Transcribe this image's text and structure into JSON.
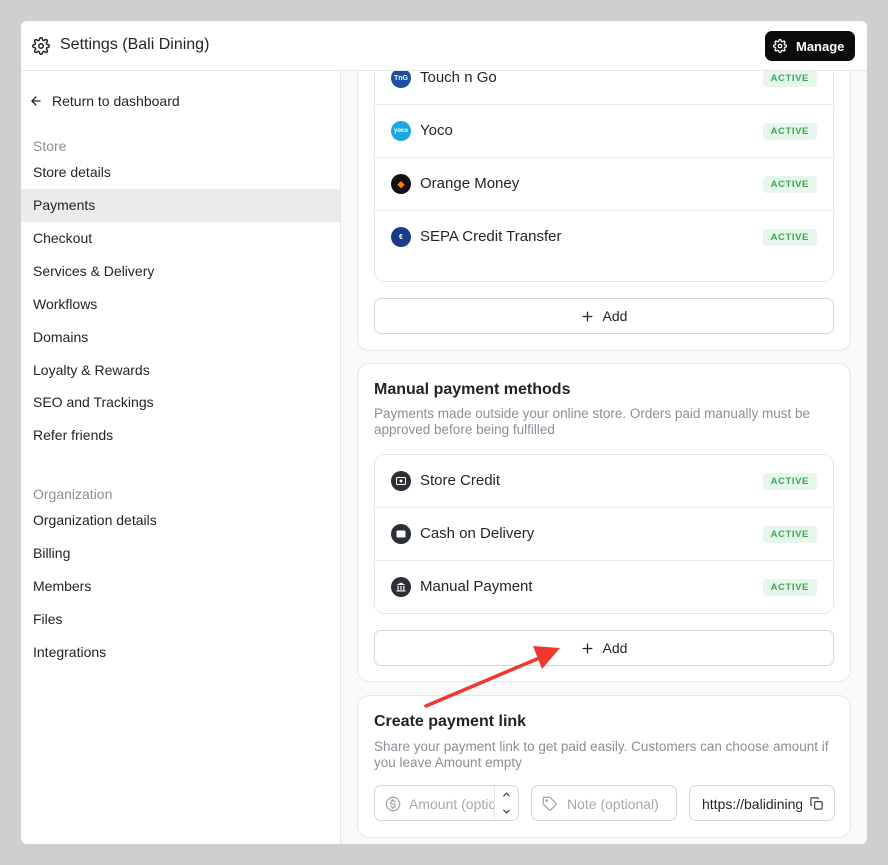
{
  "header": {
    "title": "Settings (Bali Dining)",
    "manage_label": "Manage"
  },
  "sidebar": {
    "back_label": "Return to dashboard",
    "store_label": "Store",
    "store_items": [
      "Store details",
      "Payments",
      "Checkout",
      "Services & Delivery",
      "Workflows",
      "Domains",
      "Loyalty & Rewards",
      "SEO and Trackings",
      "Refer friends"
    ],
    "org_label": "Organization",
    "org_items": [
      "Organization details",
      "Billing",
      "Members",
      "Files",
      "Integrations"
    ],
    "active_item": "Payments"
  },
  "online_methods": {
    "items": [
      {
        "name": "Touch n Go",
        "status": "ACTIVE",
        "icon": "touch-n-go-icon",
        "color": "#1a4fa3"
      },
      {
        "name": "Yoco",
        "status": "ACTIVE",
        "icon": "yoco-icon",
        "color": "#19a8e0"
      },
      {
        "name": "Orange Money",
        "status": "ACTIVE",
        "icon": "orange-money-icon",
        "color": "#111111"
      },
      {
        "name": "SEPA Credit Transfer",
        "status": "ACTIVE",
        "icon": "sepa-icon",
        "color": "#1c3a8a"
      }
    ],
    "add_label": "Add"
  },
  "manual_methods": {
    "title": "Manual payment methods",
    "description": "Payments made outside your online store. Orders paid manually must be approved before being fulfilled",
    "items": [
      {
        "name": "Store Credit",
        "status": "ACTIVE",
        "icon": "store-credit-icon"
      },
      {
        "name": "Cash on Delivery",
        "status": "ACTIVE",
        "icon": "cash-icon"
      },
      {
        "name": "Manual Payment",
        "status": "ACTIVE",
        "icon": "bank-icon"
      }
    ],
    "add_label": "Add"
  },
  "payment_link": {
    "title": "Create payment link",
    "description": "Share your payment link to get paid easily. Customers can choose amount if you leave Amount empty",
    "amount_placeholder": "Amount (optional)",
    "note_placeholder": "Note (optional)",
    "link_value": "https://balidining"
  },
  "colors": {
    "accent_dark": "#0b0b0b",
    "badge_bg": "#e7f6ea",
    "badge_text": "#3aa853",
    "annotation_arrow": "#ee3a2e"
  }
}
